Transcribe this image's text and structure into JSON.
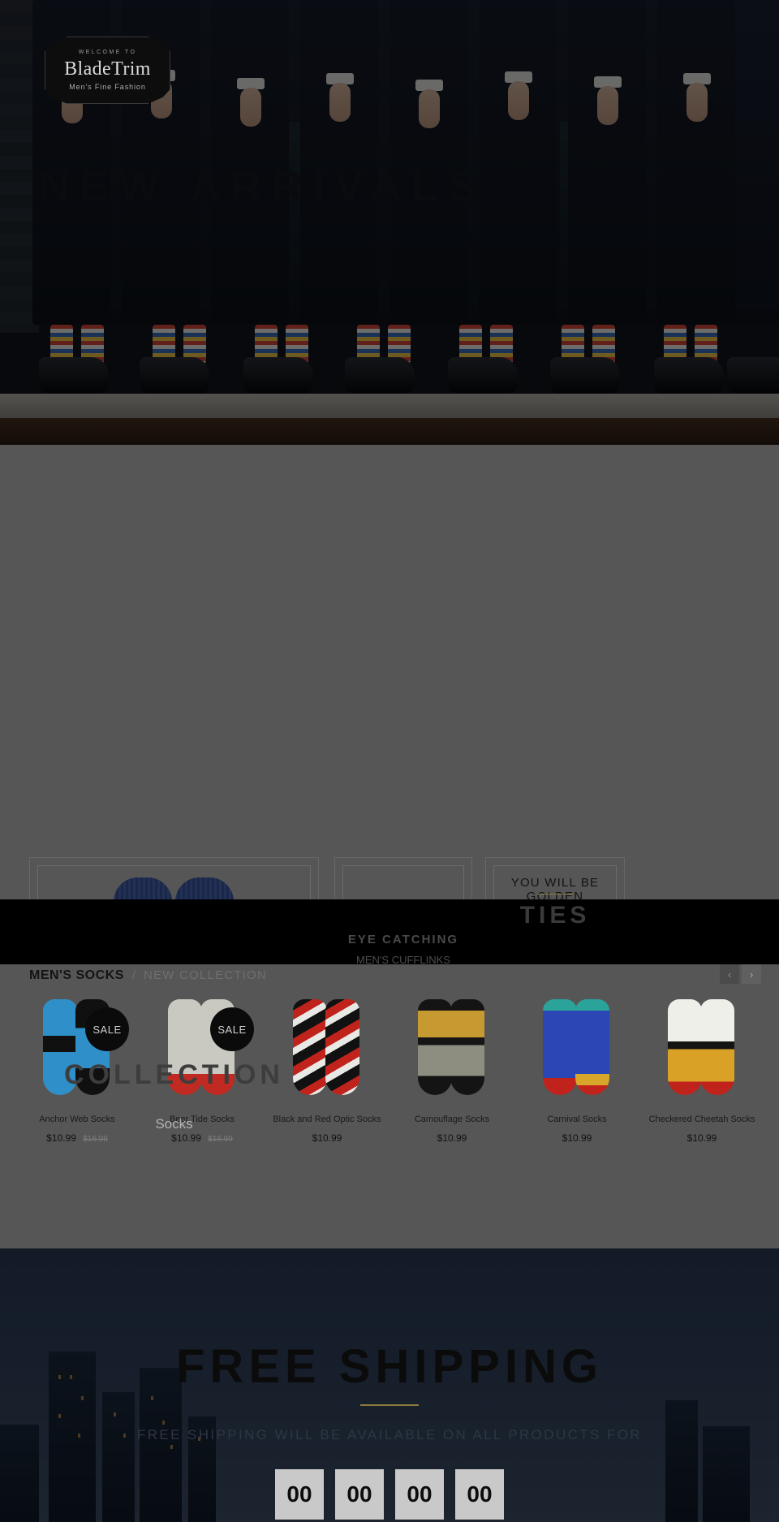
{
  "logo": {
    "welcome": "WELCOME TO",
    "name": "BladeTrim",
    "tagline": "Men's Fine Fashion"
  },
  "hero": {
    "title": "NEW ARRIVALS"
  },
  "collections": [
    {
      "id": "socks",
      "title": "",
      "subtitle": "COLLECTION",
      "category": "Socks"
    },
    {
      "id": "cufflinks",
      "title": "",
      "subtitle": "EYE CATCHING",
      "category": "MEN'S CUFFLINKS"
    },
    {
      "id": "ties",
      "title": "YOU WILL BE GOLDEN",
      "subtitle": "TIES",
      "category": ""
    }
  ],
  "product_section": {
    "heading_main": "MEN'S SOCKS",
    "heading_separator": "/",
    "heading_sub": "NEW COLLECTION",
    "prev_label": "‹",
    "next_label": "›",
    "products": [
      {
        "name": "Anchor Web Socks",
        "price": "$10.99",
        "old_price": "$16.99",
        "badge": "SALE"
      },
      {
        "name": "Beer Tide Socks",
        "price": "$10.99",
        "old_price": "$16.99",
        "badge": "SALE"
      },
      {
        "name": "Black and Red Optic Socks",
        "price": "$10.99",
        "old_price": "",
        "badge": ""
      },
      {
        "name": "Camouflage Socks",
        "price": "$10.99",
        "old_price": "",
        "badge": ""
      },
      {
        "name": "Carnival Socks",
        "price": "$10.99",
        "old_price": "",
        "badge": ""
      },
      {
        "name": "Checkered Cheetah Socks",
        "price": "$10.99",
        "old_price": "",
        "badge": ""
      }
    ]
  },
  "shipping": {
    "title": "FREE SHIPPING",
    "subtitle": "FREE SHIPPING WILL BE AVAILABLE ON ALL PRODUCTS FOR",
    "countdown": [
      "00",
      "00",
      "00",
      "00"
    ]
  },
  "colors": {
    "page_background": "#565656",
    "black_bar": "#000000",
    "accent_gold": "#8a7a3f",
    "sale_badge": "#0b0b0b",
    "shipping_sky": "#3d5068"
  }
}
